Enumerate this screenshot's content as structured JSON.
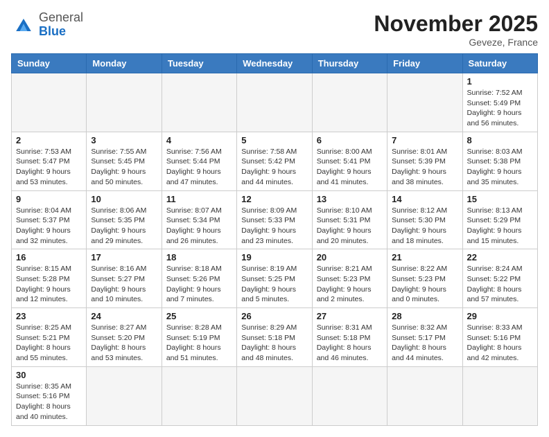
{
  "header": {
    "logo_general": "General",
    "logo_blue": "Blue",
    "month_title": "November 2025",
    "location": "Geveze, France"
  },
  "weekdays": [
    "Sunday",
    "Monday",
    "Tuesday",
    "Wednesday",
    "Thursday",
    "Friday",
    "Saturday"
  ],
  "weeks": [
    [
      {
        "day": "",
        "empty": true
      },
      {
        "day": "",
        "empty": true
      },
      {
        "day": "",
        "empty": true
      },
      {
        "day": "",
        "empty": true
      },
      {
        "day": "",
        "empty": true
      },
      {
        "day": "",
        "empty": true
      },
      {
        "day": "1",
        "info": "Sunrise: 7:52 AM\nSunset: 5:49 PM\nDaylight: 9 hours and 56 minutes."
      }
    ],
    [
      {
        "day": "2",
        "info": "Sunrise: 7:53 AM\nSunset: 5:47 PM\nDaylight: 9 hours and 53 minutes."
      },
      {
        "day": "3",
        "info": "Sunrise: 7:55 AM\nSunset: 5:45 PM\nDaylight: 9 hours and 50 minutes."
      },
      {
        "day": "4",
        "info": "Sunrise: 7:56 AM\nSunset: 5:44 PM\nDaylight: 9 hours and 47 minutes."
      },
      {
        "day": "5",
        "info": "Sunrise: 7:58 AM\nSunset: 5:42 PM\nDaylight: 9 hours and 44 minutes."
      },
      {
        "day": "6",
        "info": "Sunrise: 8:00 AM\nSunset: 5:41 PM\nDaylight: 9 hours and 41 minutes."
      },
      {
        "day": "7",
        "info": "Sunrise: 8:01 AM\nSunset: 5:39 PM\nDaylight: 9 hours and 38 minutes."
      },
      {
        "day": "8",
        "info": "Sunrise: 8:03 AM\nSunset: 5:38 PM\nDaylight: 9 hours and 35 minutes."
      }
    ],
    [
      {
        "day": "9",
        "info": "Sunrise: 8:04 AM\nSunset: 5:37 PM\nDaylight: 9 hours and 32 minutes."
      },
      {
        "day": "10",
        "info": "Sunrise: 8:06 AM\nSunset: 5:35 PM\nDaylight: 9 hours and 29 minutes."
      },
      {
        "day": "11",
        "info": "Sunrise: 8:07 AM\nSunset: 5:34 PM\nDaylight: 9 hours and 26 minutes."
      },
      {
        "day": "12",
        "info": "Sunrise: 8:09 AM\nSunset: 5:33 PM\nDaylight: 9 hours and 23 minutes."
      },
      {
        "day": "13",
        "info": "Sunrise: 8:10 AM\nSunset: 5:31 PM\nDaylight: 9 hours and 20 minutes."
      },
      {
        "day": "14",
        "info": "Sunrise: 8:12 AM\nSunset: 5:30 PM\nDaylight: 9 hours and 18 minutes."
      },
      {
        "day": "15",
        "info": "Sunrise: 8:13 AM\nSunset: 5:29 PM\nDaylight: 9 hours and 15 minutes."
      }
    ],
    [
      {
        "day": "16",
        "info": "Sunrise: 8:15 AM\nSunset: 5:28 PM\nDaylight: 9 hours and 12 minutes."
      },
      {
        "day": "17",
        "info": "Sunrise: 8:16 AM\nSunset: 5:27 PM\nDaylight: 9 hours and 10 minutes."
      },
      {
        "day": "18",
        "info": "Sunrise: 8:18 AM\nSunset: 5:26 PM\nDaylight: 9 hours and 7 minutes."
      },
      {
        "day": "19",
        "info": "Sunrise: 8:19 AM\nSunset: 5:25 PM\nDaylight: 9 hours and 5 minutes."
      },
      {
        "day": "20",
        "info": "Sunrise: 8:21 AM\nSunset: 5:23 PM\nDaylight: 9 hours and 2 minutes."
      },
      {
        "day": "21",
        "info": "Sunrise: 8:22 AM\nSunset: 5:23 PM\nDaylight: 9 hours and 0 minutes."
      },
      {
        "day": "22",
        "info": "Sunrise: 8:24 AM\nSunset: 5:22 PM\nDaylight: 8 hours and 57 minutes."
      }
    ],
    [
      {
        "day": "23",
        "info": "Sunrise: 8:25 AM\nSunset: 5:21 PM\nDaylight: 8 hours and 55 minutes."
      },
      {
        "day": "24",
        "info": "Sunrise: 8:27 AM\nSunset: 5:20 PM\nDaylight: 8 hours and 53 minutes."
      },
      {
        "day": "25",
        "info": "Sunrise: 8:28 AM\nSunset: 5:19 PM\nDaylight: 8 hours and 51 minutes."
      },
      {
        "day": "26",
        "info": "Sunrise: 8:29 AM\nSunset: 5:18 PM\nDaylight: 8 hours and 48 minutes."
      },
      {
        "day": "27",
        "info": "Sunrise: 8:31 AM\nSunset: 5:18 PM\nDaylight: 8 hours and 46 minutes."
      },
      {
        "day": "28",
        "info": "Sunrise: 8:32 AM\nSunset: 5:17 PM\nDaylight: 8 hours and 44 minutes."
      },
      {
        "day": "29",
        "info": "Sunrise: 8:33 AM\nSunset: 5:16 PM\nDaylight: 8 hours and 42 minutes."
      }
    ],
    [
      {
        "day": "30",
        "info": "Sunrise: 8:35 AM\nSunset: 5:16 PM\nDaylight: 8 hours and 40 minutes."
      },
      {
        "day": "",
        "empty": true
      },
      {
        "day": "",
        "empty": true
      },
      {
        "day": "",
        "empty": true
      },
      {
        "day": "",
        "empty": true
      },
      {
        "day": "",
        "empty": true
      },
      {
        "day": "",
        "empty": true
      }
    ]
  ]
}
